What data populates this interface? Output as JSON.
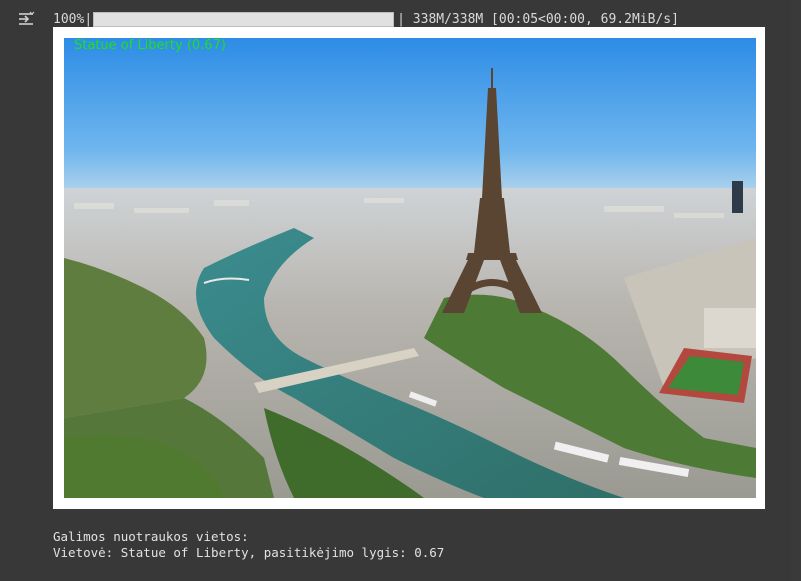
{
  "progress": {
    "percent_text": "100%",
    "fraction": 1.0,
    "stats_text": "| 338M/338M [00:05<00:00, 69.2MiB/s]"
  },
  "image": {
    "overlay_label": "Statue of Liberty (0.67)",
    "overlay_color": "#1ee01e"
  },
  "output_lines": {
    "line1": "Galimos nuotraukos vietos:",
    "line2": "Vietovė: Statue of Liberty, pasitikėjimo lygis: 0.67"
  },
  "icons": {
    "output_toggle": "output-collapse-icon"
  },
  "colors": {
    "background": "#383838",
    "text": "#d5d5d5",
    "frame": "#ffffff"
  }
}
